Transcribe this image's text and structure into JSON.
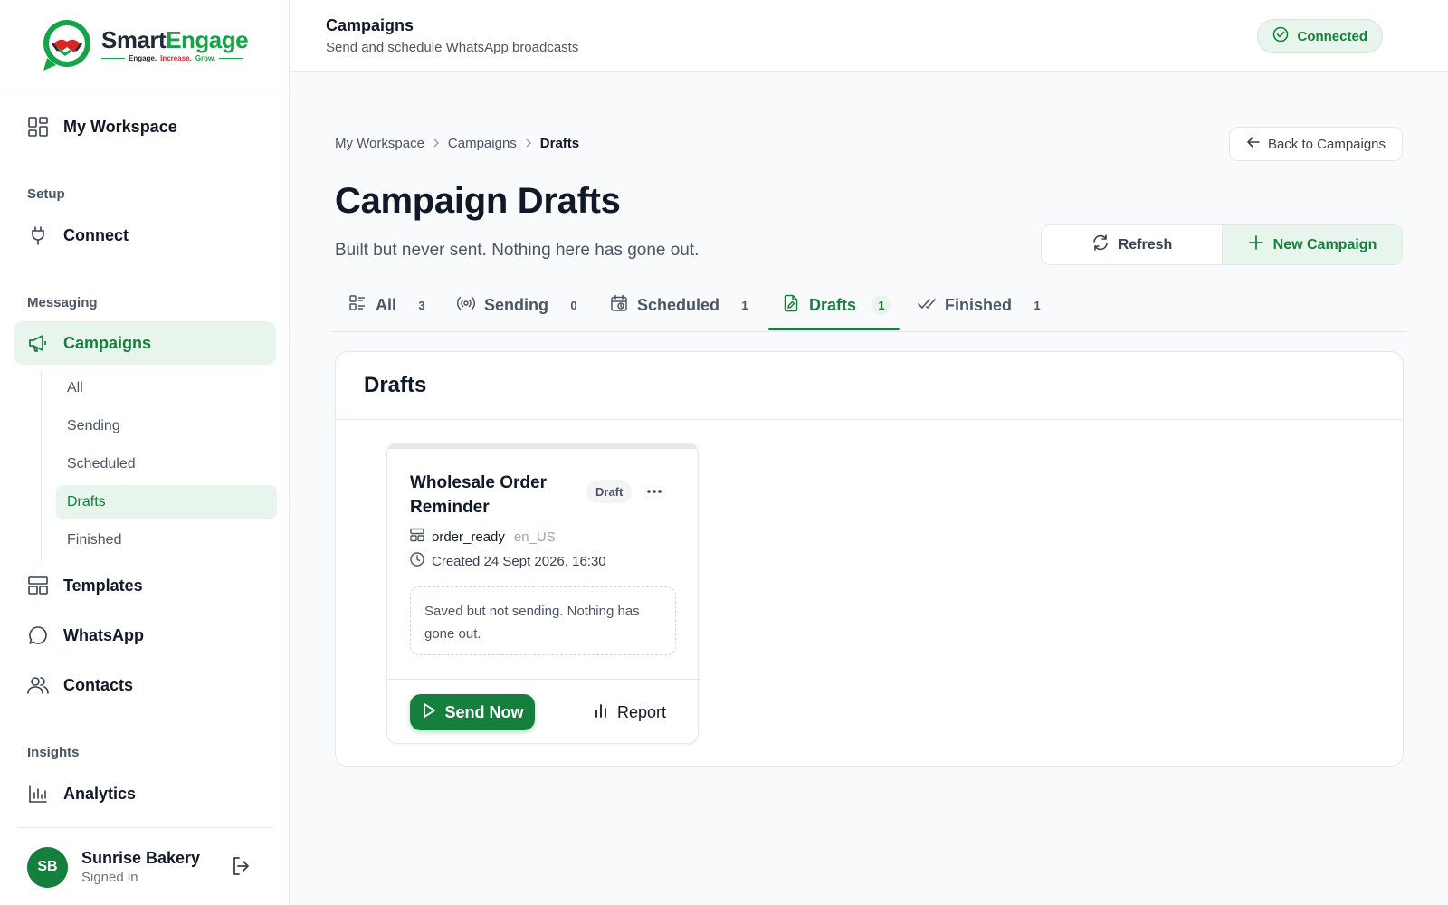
{
  "brand": {
    "name_part1": "Smart",
    "name_part2": "Engage",
    "tag1": "Engage.",
    "tag2": "Increase.",
    "tag3": "Grow.",
    "accent": "#15803d",
    "accent_light": "#e8f5ec"
  },
  "sidebar": {
    "workspace": "My Workspace",
    "sections": {
      "setup": "Setup",
      "messaging": "Messaging",
      "insights": "Insights"
    },
    "connect": "Connect",
    "campaigns": "Campaigns",
    "sub": [
      "All",
      "Sending",
      "Scheduled",
      "Drafts",
      "Finished"
    ],
    "templates": "Templates",
    "whatsapp": "WhatsApp",
    "contacts": "Contacts",
    "analytics": "Analytics",
    "profile": {
      "initials": "SB",
      "name": "Sunrise Bakery",
      "status": "Signed in"
    }
  },
  "header": {
    "title": "Campaigns",
    "subtitle": "Send and schedule WhatsApp broadcasts",
    "status": "Connected"
  },
  "breadcrumb": [
    "My Workspace",
    "Campaigns",
    "Drafts"
  ],
  "back_label": "Back to Campaigns",
  "page": {
    "title": "Campaign Drafts",
    "subtitle": "Built but never sent. Nothing here has gone out."
  },
  "actions": {
    "refresh": "Refresh",
    "new": "New Campaign"
  },
  "tabs": [
    {
      "label": "All",
      "count": "3"
    },
    {
      "label": "Sending",
      "count": "0"
    },
    {
      "label": "Scheduled",
      "count": "1"
    },
    {
      "label": "Drafts",
      "count": "1"
    },
    {
      "label": "Finished",
      "count": "1"
    }
  ],
  "panel": {
    "title": "Drafts"
  },
  "card": {
    "title": "Wholesale Order Reminder",
    "badge": "Draft",
    "template": "order_ready",
    "lang": "en_US",
    "created": "Created 24 Sept 2026, 16:30",
    "note": "Saved but not sending. Nothing has gone out.",
    "send": "Send Now",
    "report": "Report"
  }
}
